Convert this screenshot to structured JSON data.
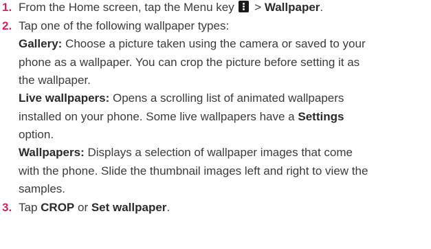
{
  "steps": [
    {
      "number": "1.",
      "text_before": "From the Home screen, tap the Menu key",
      "separator": " > ",
      "bold": "Wallpaper",
      "end": "."
    },
    {
      "number": "2.",
      "text": "Tap one of the following wallpaper types:"
    },
    {
      "number": "3.",
      "text_before": "Tap ",
      "bold1": "CROP",
      "middle": " or ",
      "bold2": "Set wallpaper",
      "end": "."
    }
  ],
  "options": {
    "gallery": {
      "label": "Gallery:",
      "lines": [
        " Choose a picture taken using the camera or saved to your",
        "phone as a wallpaper. You can crop the picture before setting it as",
        "the wallpaper."
      ]
    },
    "live": {
      "label": "Live wallpapers:",
      "lines": [
        " Opens a scrolling list of animated wallpapers",
        "installed on your phone. Some live wallpapers have a "
      ],
      "bold": "Settings",
      "last_line": "option."
    },
    "wallpapers": {
      "label": "Wallpapers:",
      "lines": [
        " Displays a selection of wallpaper images that come",
        "with the phone. Slide the thumbnail images left and right to view the",
        "samples."
      ]
    }
  },
  "colors": {
    "step_number": "#d6225a",
    "text": "#3b3b3b"
  },
  "icons": {
    "menu_key": "menu-key-icon"
  }
}
